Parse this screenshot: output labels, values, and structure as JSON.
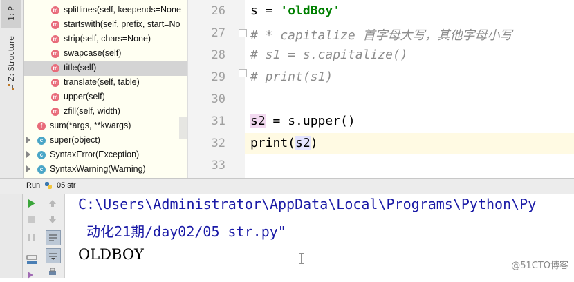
{
  "sidebar_tabs": {
    "project": "1: P",
    "structure": "Z: Structure"
  },
  "structure": {
    "items": [
      {
        "label": "splitlines(self, keepends=None",
        "icon": "m",
        "indent": 2,
        "selected": false,
        "expandable": false
      },
      {
        "label": "startswith(self, prefix, start=No",
        "icon": "m",
        "indent": 2,
        "selected": false,
        "expandable": false
      },
      {
        "label": "strip(self, chars=None)",
        "icon": "m",
        "indent": 2,
        "selected": false,
        "expandable": false
      },
      {
        "label": "swapcase(self)",
        "icon": "m",
        "indent": 2,
        "selected": false,
        "expandable": false
      },
      {
        "label": "title(self)",
        "icon": "m",
        "indent": 2,
        "selected": true,
        "expandable": false
      },
      {
        "label": "translate(self, table)",
        "icon": "m",
        "indent": 2,
        "selected": false,
        "expandable": false
      },
      {
        "label": "upper(self)",
        "icon": "m",
        "indent": 2,
        "selected": false,
        "expandable": false
      },
      {
        "label": "zfill(self, width)",
        "icon": "m",
        "indent": 2,
        "selected": false,
        "expandable": false
      },
      {
        "label": "sum(*args, **kwargs)",
        "icon": "f",
        "indent": 1,
        "selected": false,
        "expandable": false
      },
      {
        "label": "super(object)",
        "icon": "c",
        "indent": 1,
        "selected": false,
        "expandable": true
      },
      {
        "label": "SyntaxError(Exception)",
        "icon": "c",
        "indent": 1,
        "selected": false,
        "expandable": true
      },
      {
        "label": "SyntaxWarning(Warning)",
        "icon": "c",
        "indent": 1,
        "selected": false,
        "expandable": true
      }
    ]
  },
  "editor": {
    "line_numbers": [
      "26",
      "27",
      "28",
      "29",
      "30",
      "31",
      "32",
      "33"
    ],
    "lines": {
      "l26_var": "s = ",
      "l26_str": "'oldBoy'",
      "l27": "# * capitalize 首字母大写，其他字母小写",
      "l28": "# s1 = s.capitalize()",
      "l29": "# print(s1)",
      "l31_var": "s2",
      "l31_rest": " = s.upper()",
      "l32_a": "print(",
      "l32_var": "s2",
      "l32_b": ")"
    }
  },
  "run": {
    "label": "Run",
    "tab_name": "05 str"
  },
  "console": {
    "path_line_1": "C:\\Users\\Administrator\\AppData\\Local\\Programs\\Python\\Py",
    "path_line_2": " 动化21期/day02/05 str.py\"",
    "output": "OLDBOY"
  },
  "watermark": "@51CTO博客",
  "colors": {
    "structure_bg": "#fffff2",
    "current_line": "#fffae3",
    "comment": "#8c8c8c",
    "string": "#008000",
    "console_path": "#1a1aa6"
  }
}
